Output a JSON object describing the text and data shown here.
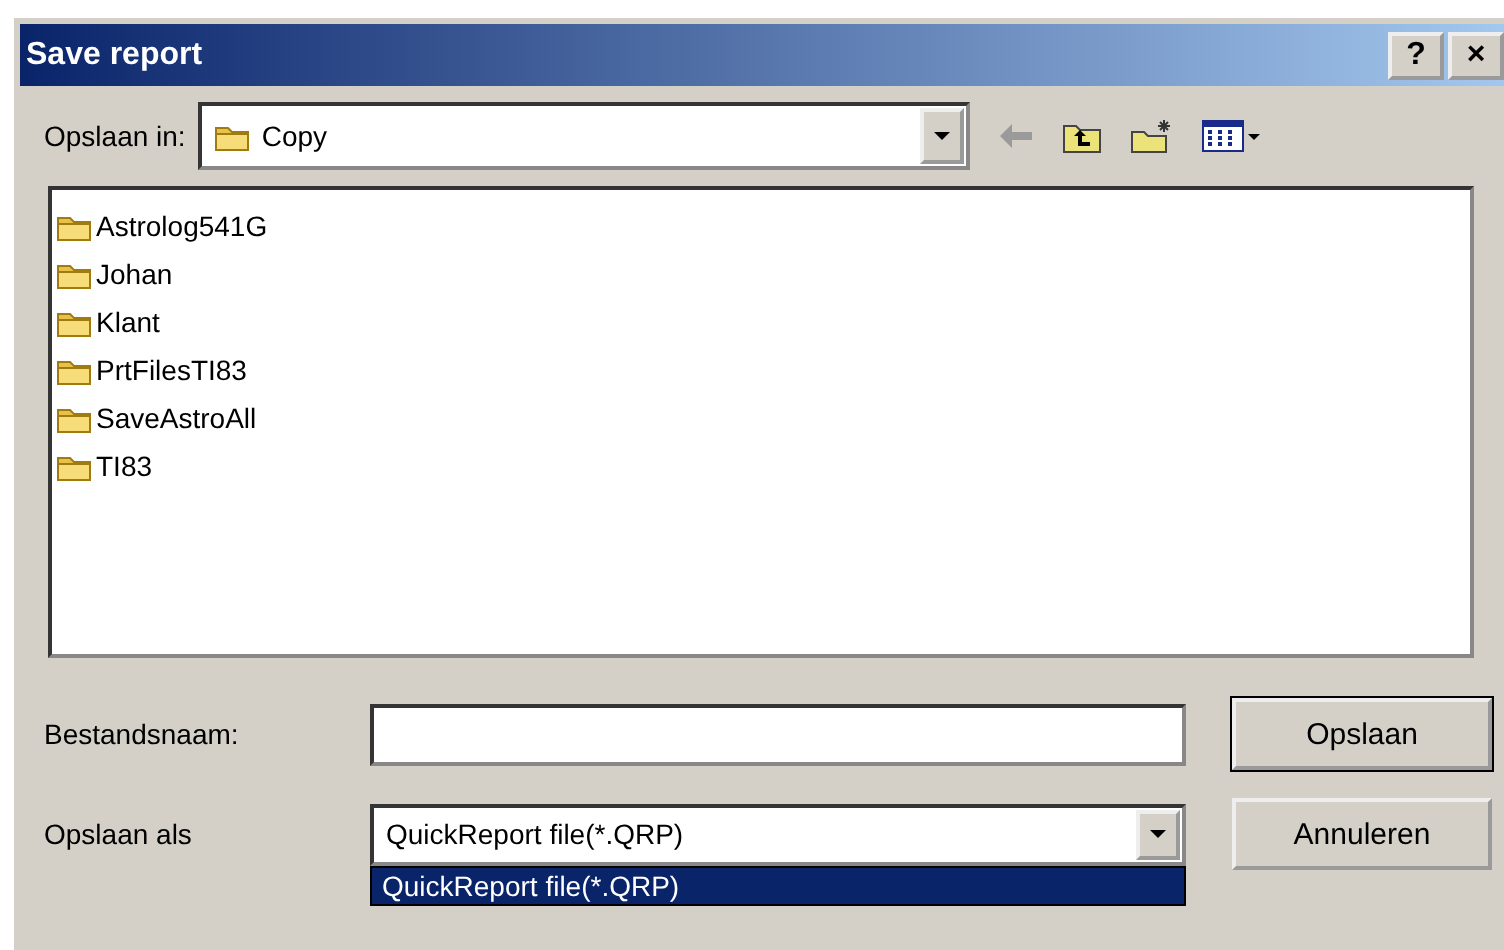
{
  "window": {
    "title": "Save report",
    "help_button": "?",
    "close_button": "×"
  },
  "location": {
    "label": "Opslaan in:",
    "value": "Copy"
  },
  "files": [
    {
      "name": "Astrolog541G"
    },
    {
      "name": "Johan"
    },
    {
      "name": "Klant"
    },
    {
      "name": "PrtFilesTI83"
    },
    {
      "name": "SaveAstroAll"
    },
    {
      "name": "TI83"
    }
  ],
  "filename": {
    "label": "Bestandsnaam:"
  },
  "filetype": {
    "label": "Opslaan als",
    "value": "QuickReport file(*.QRP)",
    "options": [
      {
        "label": "QuickReport file(*.QRP)",
        "selected": true
      }
    ]
  },
  "buttons": [
    {
      "label": "Opslaan",
      "default": true
    },
    {
      "label": "Annuleren",
      "default": false
    }
  ]
}
